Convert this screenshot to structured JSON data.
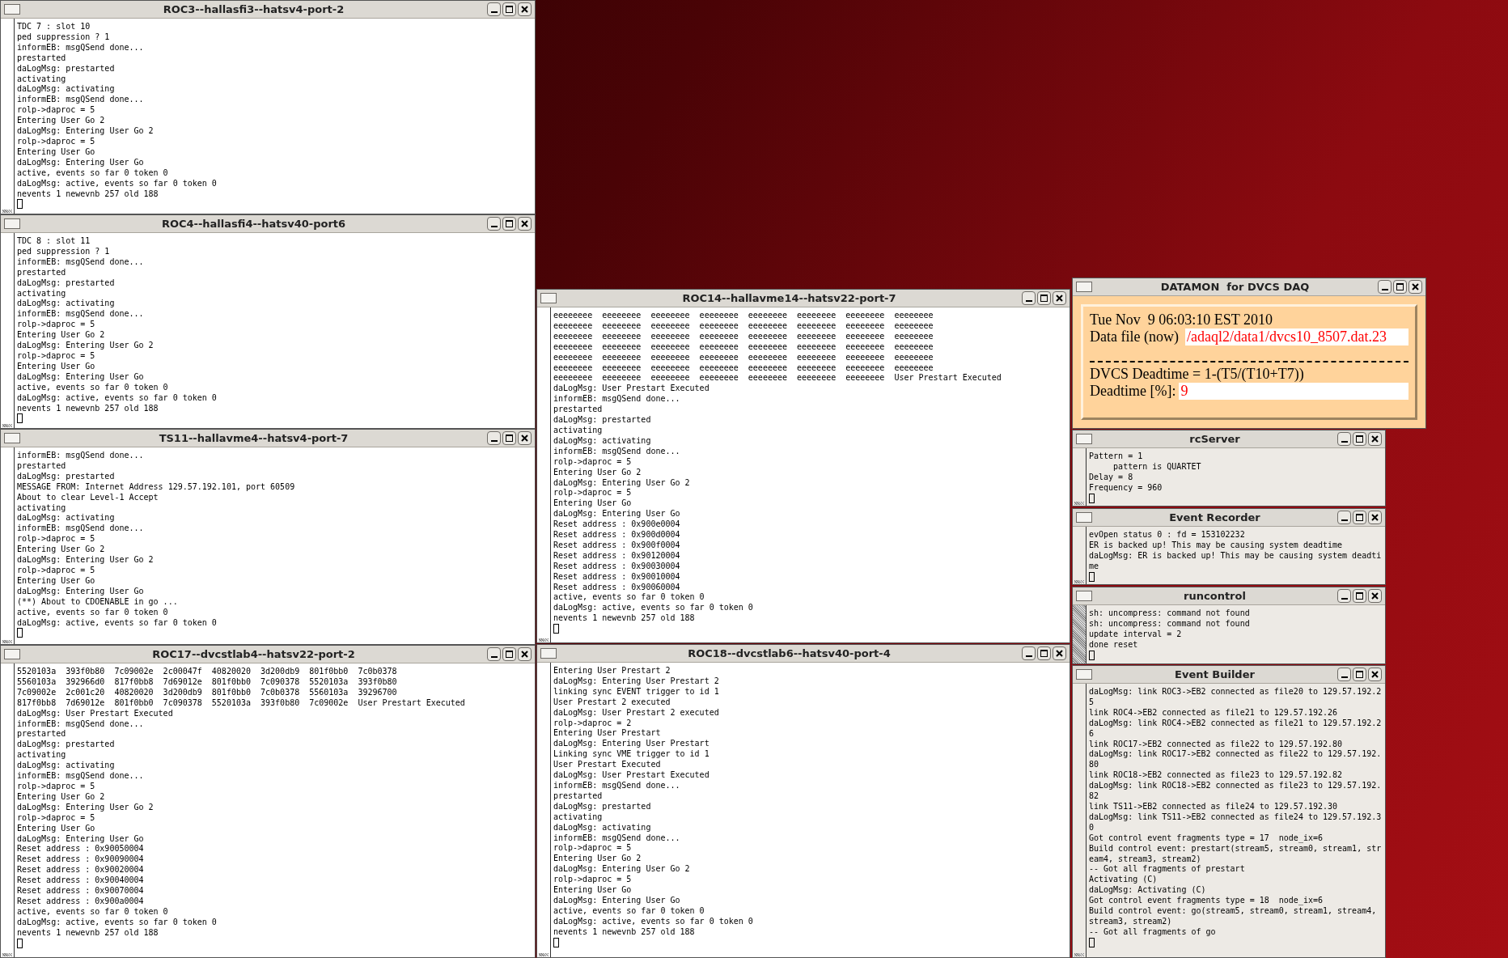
{
  "windows": [
    {
      "kind": "terminal",
      "title": "ROC3--hallasfi3--hatsv4-port-2",
      "lines": [
        "TDC 7 : slot 10",
        "ped suppression ? 1",
        "informEB: msgQSend done...",
        "prestarted",
        "daLogMsg: prestarted",
        "activating",
        "daLogMsg: activating",
        "informEB: msgQSend done...",
        "rolp->daproc = 5",
        "Entering User Go 2",
        "daLogMsg: Entering User Go 2",
        "rolp->daproc = 5",
        "Entering User Go",
        "daLogMsg: Entering User Go",
        "active, events so far 0 token 0",
        "daLogMsg: active, events so far 0 token 0",
        "nevents 1 newevnb 257 old 188"
      ]
    },
    {
      "kind": "terminal",
      "title": "ROC4--hallasfi4--hatsv40-port6",
      "lines": [
        "TDC 8 : slot 11",
        "ped suppression ? 1",
        "informEB: msgQSend done...",
        "prestarted",
        "daLogMsg: prestarted",
        "activating",
        "daLogMsg: activating",
        "informEB: msgQSend done...",
        "rolp->daproc = 5",
        "Entering User Go 2",
        "daLogMsg: Entering User Go 2",
        "rolp->daproc = 5",
        "Entering User Go",
        "daLogMsg: Entering User Go",
        "active, events so far 0 token 0",
        "daLogMsg: active, events so far 0 token 0",
        "nevents 1 newevnb 257 old 188"
      ]
    },
    {
      "kind": "terminal",
      "title": "TS11--hallavme4--hatsv4-port-7",
      "lines": [
        "informEB: msgQSend done...",
        "prestarted",
        "daLogMsg: prestarted",
        "MESSAGE FROM: Internet Address 129.57.192.101, port 60509",
        "About to clear Level-1 Accept",
        "activating",
        "daLogMsg: activating",
        "informEB: msgQSend done...",
        "rolp->daproc = 5",
        "Entering User Go 2",
        "daLogMsg: Entering User Go 2",
        "rolp->daproc = 5",
        "Entering User Go",
        "daLogMsg: Entering User Go",
        "(**) About to CDOENABLE in go ...",
        "active, events so far 0 token 0",
        "daLogMsg: active, events so far 0 token 0"
      ]
    },
    {
      "kind": "terminal",
      "title": "ROC17--dvcstlab4--hatsv22-port-2",
      "lines": [
        "5520103a  393f0b80  7c09002e  2c00047f  40820020  3d200db9  801f0bb0  7c0b0378",
        "5560103a  392966d0  817f0bb8  7d69012e  801f0bb0  7c090378  5520103a  393f0b80",
        "7c09002e  2c001c20  40820020  3d200db9  801f0bb0  7c0b0378  5560103a  39296700",
        "817f0bb8  7d69012e  801f0bb0  7c090378  5520103a  393f0b80  7c09002e  User Prestart Executed",
        "daLogMsg: User Prestart Executed",
        "informEB: msgQSend done...",
        "prestarted",
        "daLogMsg: prestarted",
        "activating",
        "daLogMsg: activating",
        "informEB: msgQSend done...",
        "rolp->daproc = 5",
        "Entering User Go 2",
        "daLogMsg: Entering User Go 2",
        "rolp->daproc = 5",
        "Entering User Go",
        "daLogMsg: Entering User Go",
        "Reset address : 0x90050004",
        "Reset address : 0x90090004",
        "Reset address : 0x90020004",
        "Reset address : 0x90040004",
        "Reset address : 0x90070004",
        "Reset address : 0x900a0004",
        "active, events so far 0 token 0",
        "daLogMsg: active, events so far 0 token 0",
        "nevents 1 newevnb 257 old 188"
      ]
    },
    {
      "kind": "terminal",
      "title": "ROC14--hallavme14--hatsv22-port-7",
      "lines": [
        "eeeeeeee  eeeeeeee  eeeeeeee  eeeeeeee  eeeeeeee  eeeeeeee  eeeeeeee  eeeeeeee",
        "eeeeeeee  eeeeeeee  eeeeeeee  eeeeeeee  eeeeeeee  eeeeeeee  eeeeeeee  eeeeeeee",
        "eeeeeeee  eeeeeeee  eeeeeeee  eeeeeeee  eeeeeeee  eeeeeeee  eeeeeeee  eeeeeeee",
        "eeeeeeee  eeeeeeee  eeeeeeee  eeeeeeee  eeeeeeee  eeeeeeee  eeeeeeee  eeeeeeee",
        "eeeeeeee  eeeeeeee  eeeeeeee  eeeeeeee  eeeeeeee  eeeeeeee  eeeeeeee  eeeeeeee",
        "eeeeeeee  eeeeeeee  eeeeeeee  eeeeeeee  eeeeeeee  eeeeeeee  eeeeeeee  eeeeeeee",
        "eeeeeeee  eeeeeeee  eeeeeeee  eeeeeeee  eeeeeeee  eeeeeeee  eeeeeeee  User Prestart Executed",
        "daLogMsg: User Prestart Executed",
        "informEB: msgQSend done...",
        "prestarted",
        "daLogMsg: prestarted",
        "activating",
        "daLogMsg: activating",
        "informEB: msgQSend done...",
        "rolp->daproc = 5",
        "Entering User Go 2",
        "daLogMsg: Entering User Go 2",
        "rolp->daproc = 5",
        "Entering User Go",
        "daLogMsg: Entering User Go",
        "Reset address : 0x900e0004",
        "Reset address : 0x900d0004",
        "Reset address : 0x900f0004",
        "Reset address : 0x90120004",
        "Reset address : 0x90030004",
        "Reset address : 0x90010004",
        "Reset address : 0x90060004",
        "active, events so far 0 token 0",
        "daLogMsg: active, events so far 0 token 0",
        "nevents 1 newevnb 257 old 188"
      ]
    },
    {
      "kind": "terminal",
      "title": "ROC18--dvcstlab6--hatsv40-port-4",
      "lines": [
        "Entering User Prestart 2",
        "daLogMsg: Entering User Prestart 2",
        "linking sync EVENT trigger to id 1",
        "User Prestart 2 executed",
        "daLogMsg: User Prestart 2 executed",
        "rolp->daproc = 2",
        "Entering User Prestart",
        "daLogMsg: Entering User Prestart",
        "Linking sync VME trigger to id 1",
        "User Prestart Executed",
        "daLogMsg: User Prestart Executed",
        "informEB: msgQSend done...",
        "prestarted",
        "daLogMsg: prestarted",
        "activating",
        "daLogMsg: activating",
        "informEB: msgQSend done...",
        "rolp->daproc = 5",
        "Entering User Go 2",
        "daLogMsg: Entering User Go 2",
        "rolp->daproc = 5",
        "Entering User Go",
        "daLogMsg: Entering User Go",
        "active, events so far 0 token 0",
        "daLogMsg: active, events so far 0 token 0",
        "nevents 1 newevnb 257 old 188"
      ]
    },
    {
      "kind": "monitor",
      "title": "DATAMON  for DVCS DAQ",
      "date": "Tue Nov  9 06:03:10 EST 2010",
      "file_label": "Data file (now)",
      "file_value": "/adaql2/data1/dvcs10_8507.dat.23",
      "formula": "DVCS Deadtime = 1-(T5/(T10+T7))",
      "deadtime_label": "Deadtime [%]:",
      "deadtime_value": "9"
    },
    {
      "kind": "terminal",
      "title": "rcServer",
      "lines": [
        "Pattern = 1",
        "     pattern is QUARTET",
        "Delay = 8",
        "Frequency = 960"
      ]
    },
    {
      "kind": "terminal",
      "title": "Event Recorder",
      "lines": [
        "evOpen status 0 : fd = 153102232",
        "ER is backed up! This may be causing system deadtime",
        "daLogMsg: ER is backed up! This may be causing system deadti",
        "me"
      ]
    },
    {
      "kind": "terminal",
      "title": "runcontrol",
      "lines": [
        "sh: uncompress: command not found",
        "sh: uncompress: command not found",
        "update interval = 2",
        "done reset"
      ]
    },
    {
      "kind": "terminal",
      "title": "Event Builder",
      "lines": [
        "daLogMsg: link ROC3->EB2 connected as file20 to 129.57.192.2",
        "5",
        "link ROC4->EB2 connected as file21 to 129.57.192.26",
        "daLogMsg: link ROC4->EB2 connected as file21 to 129.57.192.2",
        "6",
        "link ROC17->EB2 connected as file22 to 129.57.192.80",
        "daLogMsg: link ROC17->EB2 connected as file22 to 129.57.192.",
        "80",
        "link ROC18->EB2 connected as file23 to 129.57.192.82",
        "daLogMsg: link ROC18->EB2 connected as file23 to 129.57.192.",
        "82",
        "link TS11->EB2 connected as file24 to 129.57.192.30",
        "daLogMsg: link TS11->EB2 connected as file24 to 129.57.192.3",
        "0",
        "Got control event fragments type = 17  node_ix=6",
        "Build control event: prestart(stream5, stream0, stream1, str",
        "eam4, stream3, stream2)",
        "-- Got all fragments of prestart",
        "Activating (C)",
        "daLogMsg: Activating (C)",
        "Got control event fragments type = 18  node_ix=6",
        "Build control event: go(stream5, stream0, stream1, stream4,",
        "stream3, stream2)",
        "-- Got all fragments of go"
      ]
    }
  ]
}
